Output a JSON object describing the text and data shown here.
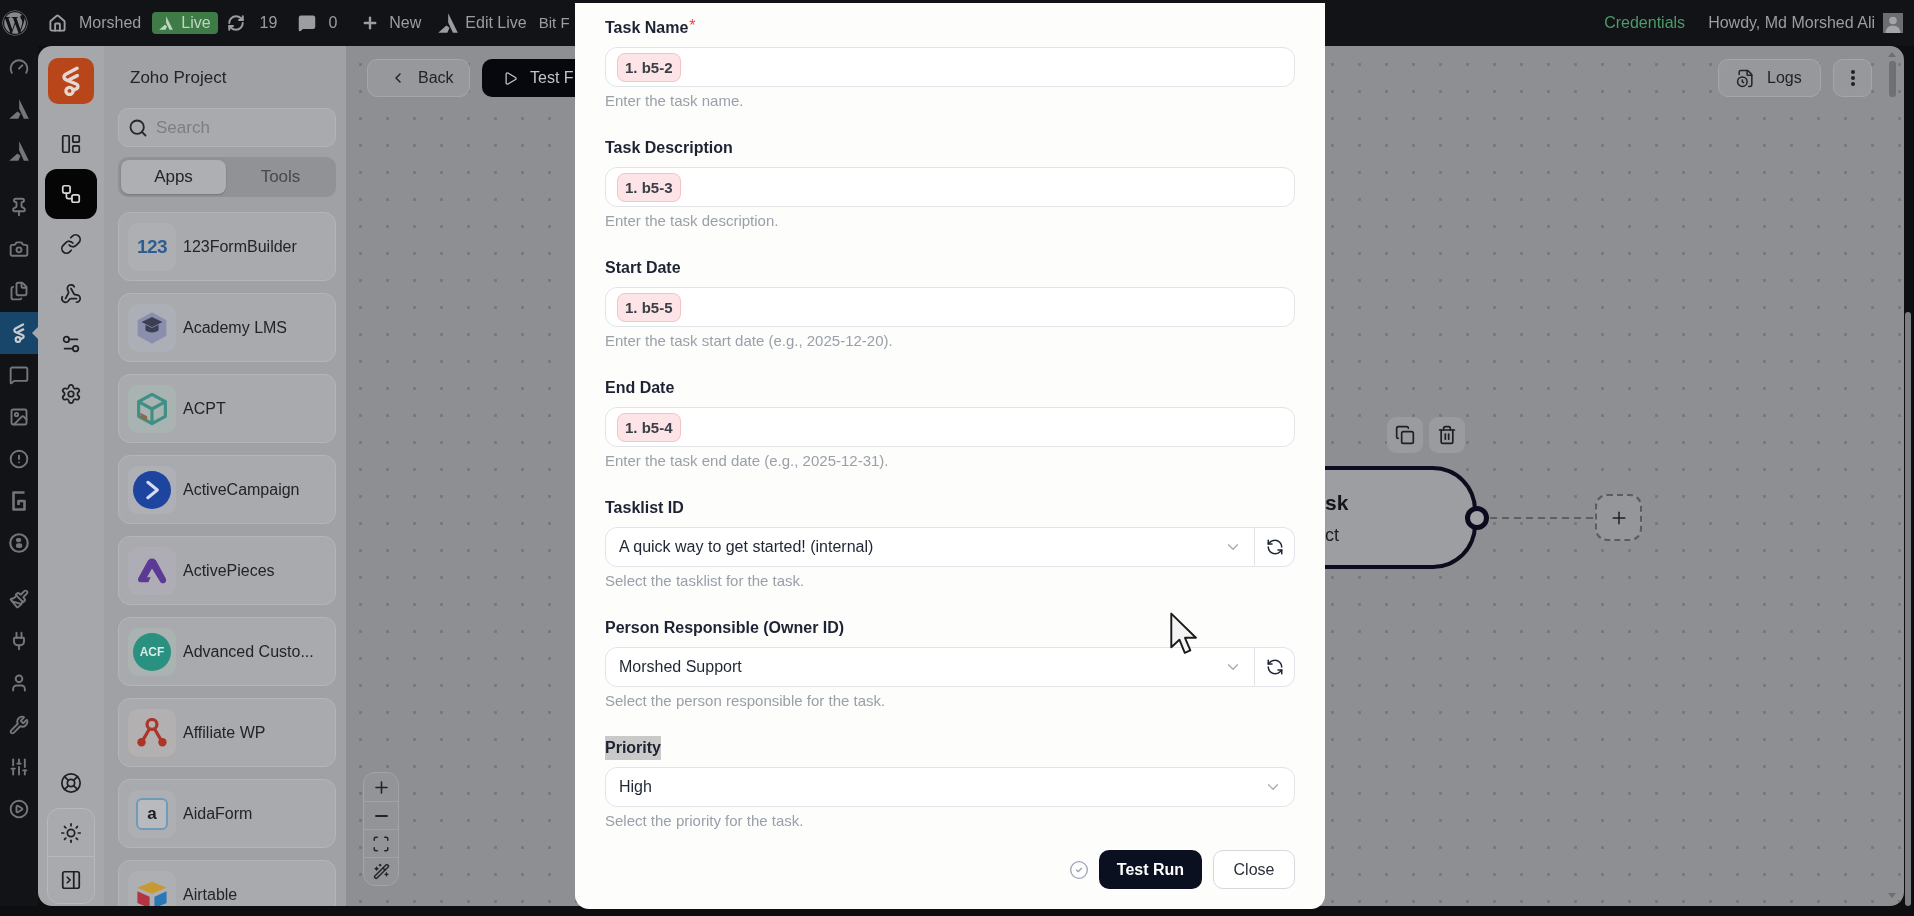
{
  "admin_bar": {
    "site_name": "Morshed",
    "live_badge": "Live",
    "updates_count": "19",
    "comments_count": "0",
    "new_label": "New",
    "edit_live_label": "Edit Live",
    "plugin_label": "Bit F",
    "credentials_link": "Credentials",
    "greeting": "Howdy, Md Morshed Ali"
  },
  "admin_menu": {
    "items": [
      {
        "selected": false
      },
      {
        "selected": false
      },
      {
        "selected": false
      },
      {
        "selected": false
      },
      {
        "selected": false
      },
      {
        "selected": false
      },
      {
        "selected": true
      },
      {
        "selected": false
      },
      {
        "selected": false
      },
      {
        "selected": false
      },
      {
        "selected": false
      },
      {
        "selected": false
      },
      {
        "selected": false
      },
      {
        "selected": false
      },
      {
        "selected": false
      },
      {
        "selected": false
      },
      {
        "selected": false
      },
      {
        "selected": false
      }
    ]
  },
  "app_rail": {
    "items": [
      {
        "selected": false
      },
      {
        "selected": true
      },
      {
        "selected": false
      },
      {
        "selected": false
      },
      {
        "selected": false
      },
      {
        "selected": false
      }
    ]
  },
  "apps_panel": {
    "title": "Zoho Project",
    "search": {
      "placeholder": "Search"
    },
    "tabs": [
      {
        "label": "Apps",
        "selected": true
      },
      {
        "label": "Tools",
        "selected": false
      }
    ],
    "apps": [
      {
        "name": "123FormBuilder",
        "logo_text": "123"
      },
      {
        "name": "Academy LMS"
      },
      {
        "name": "ACPT"
      },
      {
        "name": "ActiveCampaign"
      },
      {
        "name": "ActivePieces"
      },
      {
        "name": "Advanced Custo...",
        "logo_text": "ACF"
      },
      {
        "name": "Affiliate WP"
      },
      {
        "name": "AidaForm",
        "logo_text": "a"
      },
      {
        "name": "Airtable"
      }
    ]
  },
  "canvas": {
    "back_button": "Back",
    "test_button": "Test F",
    "logs_button": "Logs",
    "node": {
      "title": "sk",
      "subtitle": "ct"
    }
  },
  "modal": {
    "fields": [
      {
        "kind": "token",
        "label": "Task Name",
        "required_mark": "*",
        "highlighted": false,
        "token": "1. b5-2",
        "help": "Enter the task name."
      },
      {
        "kind": "token",
        "label": "Task Description",
        "highlighted": false,
        "token": "1. b5-3",
        "help": "Enter the task description."
      },
      {
        "kind": "token",
        "label": "Start Date",
        "highlighted": false,
        "token": "1. b5-5",
        "help": "Enter the task start date (e.g., 2025-12-20)."
      },
      {
        "kind": "token",
        "label": "End Date",
        "highlighted": false,
        "token": "1. b5-4",
        "help": "Enter the task end date (e.g., 2025-12-31)."
      },
      {
        "kind": "select",
        "label": "Tasklist ID",
        "highlighted": false,
        "value": "A quick way to get started! (internal)",
        "refresh_button": true,
        "help": "Select the tasklist for the task."
      },
      {
        "kind": "select",
        "label": "Person Responsible (Owner ID)",
        "highlighted": false,
        "value": "Morshed Support",
        "refresh_button": true,
        "help": "Select the person responsible for the task."
      },
      {
        "kind": "select",
        "label": "Priority",
        "highlighted": true,
        "value": "High",
        "refresh_button": false,
        "help": "Select the priority for the task."
      }
    ],
    "test_run_button": "Test Run",
    "close_button": "Close"
  }
}
